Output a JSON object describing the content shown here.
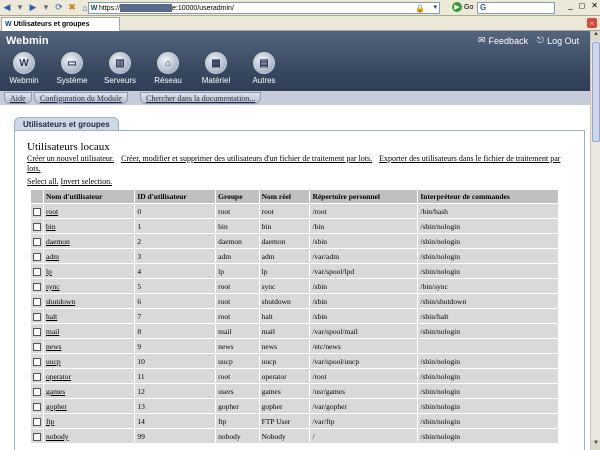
{
  "browser": {
    "url_prefix": "https://",
    "url_suffix": "e:10000/useradmin/",
    "go_label": "Go",
    "search_letter": "G",
    "tab_title": "Utilisateurs et groupes",
    "win_min": "_",
    "win_max": "◻",
    "win_close": "✕",
    "tab_close": "×"
  },
  "webmin": {
    "brand": "Webmin",
    "feedback": "Feedback",
    "logout": "Log Out",
    "categories": [
      {
        "label": "Webmin",
        "icon": "W"
      },
      {
        "label": "Système",
        "icon": "▭"
      },
      {
        "label": "Serveurs",
        "icon": "▥"
      },
      {
        "label": "Réseau",
        "icon": "⌂"
      },
      {
        "label": "Matériel",
        "icon": "▦"
      },
      {
        "label": "Autres",
        "icon": "▤"
      }
    ],
    "links": [
      "Aide",
      "Configuration du Module",
      "Chercher dans la documentation..."
    ]
  },
  "main": {
    "section_tab": "Utilisateurs et groupes",
    "title": "Utilisateurs locaux",
    "actions": [
      "Créer un nouvel utilisateur.",
      "Créer, modifier et supprimer des utilisateurs d'un fichier de traitement par lots.",
      "Exporter des utilisateurs dans le fichier de traitement par lots."
    ],
    "select_all": "Select all.",
    "invert": "Invert selection."
  },
  "table": {
    "headers": [
      "Nom d'utilisateur",
      "ID d'utilisateur",
      "Groupe",
      "Nom réel",
      "Répertoire personnel",
      "Interpréteur de commandes"
    ],
    "rows": [
      [
        "root",
        "0",
        "root",
        "root",
        "/root",
        "/bin/bash"
      ],
      [
        "bin",
        "1",
        "bin",
        "bin",
        "/bin",
        "/sbin/nologin"
      ],
      [
        "daemon",
        "2",
        "daemon",
        "daemon",
        "/sbin",
        "/sbin/nologin"
      ],
      [
        "adm",
        "3",
        "adm",
        "adm",
        "/var/adm",
        "/sbin/nologin"
      ],
      [
        "lp",
        "4",
        "lp",
        "lp",
        "/var/spool/lpd",
        "/sbin/nologin"
      ],
      [
        "sync",
        "5",
        "root",
        "sync",
        "/sbin",
        "/bin/sync"
      ],
      [
        "shutdown",
        "6",
        "root",
        "shutdown",
        "/sbin",
        "/sbin/shutdown"
      ],
      [
        "halt",
        "7",
        "root",
        "halt",
        "/sbin",
        "/sbin/halt"
      ],
      [
        "mail",
        "8",
        "mail",
        "mail",
        "/var/spool/mail",
        "/sbin/nologin"
      ],
      [
        "news",
        "9",
        "news",
        "news",
        "/etc/news",
        ""
      ],
      [
        "uucp",
        "10",
        "uucp",
        "uucp",
        "/var/spool/uucp",
        "/sbin/nologin"
      ],
      [
        "operator",
        "11",
        "root",
        "operator",
        "/root",
        "/sbin/nologin"
      ],
      [
        "games",
        "12",
        "users",
        "games",
        "/usr/games",
        "/sbin/nologin"
      ],
      [
        "gopher",
        "13",
        "gopher",
        "gopher",
        "/var/gopher",
        "/sbin/nologin"
      ],
      [
        "ftp",
        "14",
        "ftp",
        "FTP User",
        "/var/ftp",
        "/sbin/nologin"
      ],
      [
        "nobody",
        "99",
        "nobody",
        "Nobody",
        "/",
        "/sbin/nologin"
      ]
    ]
  }
}
